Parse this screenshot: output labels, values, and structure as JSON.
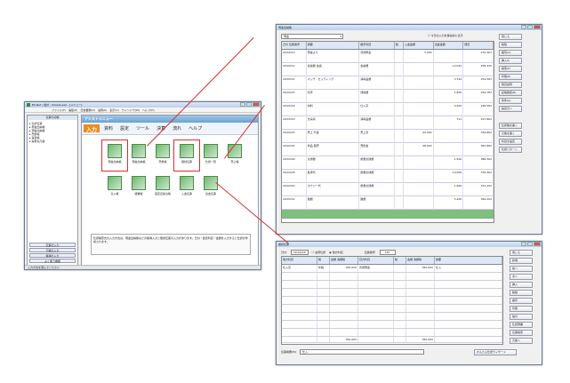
{
  "main_window": {
    "title": "BS-Net / 会計 - Simple.aad - [メニュー]",
    "menu": [
      "ファイル(F)",
      "編集(E)",
      "日常業務(D)",
      "決算(K)",
      "表示(V)",
      "ウィンドウ(W)",
      "ヘルプ(H)"
    ],
    "sidebar_title": "伝票の記帳",
    "tree": [
      "仕訳伝票",
      "現金出納帳",
      "預金出納帳",
      "売掛帳",
      "買掛帳",
      "得意先元帳"
    ],
    "sidebar_buttons": [
      "伝票の入力",
      "元帳の入力",
      "帳簿の入力",
      "よく使う機能"
    ],
    "assist_title": "アシストメニュー",
    "tabs": [
      "入力",
      "資料",
      "設定",
      "ツール",
      "決算",
      "流れ",
      "ヘルプ"
    ],
    "icons": [
      "現金出納帳",
      "預金出納帳",
      "売掛帳",
      "振替伝票",
      "仕訳一覧",
      "売上帳",
      "仕入帳",
      "経費帳",
      "固定資産台帳",
      "入金伝票",
      "出金伝票"
    ],
    "description": "仕訳帳形式の入力方法は、現金出納帳などの帳簿入力と振替伝票の入力があります。日付・勘定科目・金額を入力すると仕訳が作成されます。",
    "status": "入力方法を選んでください"
  },
  "cash_window": {
    "title": "現金出納帳",
    "account": "現金",
    "checkbox_label": "今日の入力を優先的に表示",
    "headers": [
      "日付 伝票番号",
      "摘要",
      "相手科目",
      "税",
      "入金金額",
      "出金金額",
      "残高"
    ],
    "rows": [
      [
        "20/03/10",
        "預金より",
        "普通預金",
        "",
        "3,000",
        "",
        "270,367"
      ],
      [
        "20/03/12",
        "会議費 会議",
        "会議費",
        "",
        "",
        "12,042",
        "258,325"
      ],
      [
        "20/03/12",
        "マッチ、セッティング",
        "消耗品費",
        "",
        "",
        "3,742",
        "254,583"
      ],
      [
        "20/03/15",
        "切手",
        "通信費",
        "",
        "",
        "1,800",
        "252,783"
      ],
      [
        "20/03/18",
        "材料",
        "仕入高",
        "",
        "",
        "4,200",
        "248,583"
      ],
      [
        "20/03/20",
        "文房具",
        "消耗品費",
        "",
        "",
        "721",
        "247,862"
      ],
      [
        "20/03/25",
        "売上 代金",
        "売上高",
        "",
        "92,000",
        "",
        "339,862"
      ],
      [
        "20/03/25",
        "商品 販売",
        "売掛金",
        "",
        "48,000",
        "",
        "387,862"
      ],
      [
        "20/03/28",
        "交通費",
        "旅費交通費",
        "",
        "",
        "1,500",
        "386,362"
      ],
      [
        "20/03/28",
        "駐車代",
        "旅費交通費",
        "",
        "",
        "10,000",
        "376,362"
      ],
      [
        "20/03/29",
        "タクシー代",
        "旅費交通費",
        "",
        "",
        "1,960",
        "374,402"
      ],
      [
        "20/03/31",
        "雑費",
        "雑費",
        "",
        "",
        "5,200",
        "369,202"
      ]
    ],
    "buttons": [
      "閉じる",
      "削除",
      "複写(C)",
      "挿入(I)",
      "検索(F)",
      "印刷(P)",
      "残高試算",
      "記帳確認(R)",
      "条件(A)",
      "指定日へ"
    ],
    "side_buttons2": [
      "仕訳帳を開く",
      "元帳を開く",
      "科目を設定",
      "仕訳パターン"
    ]
  },
  "voucher_window": {
    "title": "振替伝票",
    "date_label": "日付:",
    "date": "20/04/28",
    "options": [
      "決算仕訳",
      "借方科目"
    ],
    "number_label": "伝票番号:",
    "number": "267",
    "headers": [
      "借方科目",
      "税",
      "金額 消費税",
      "貸方科目",
      "税",
      "金額 消費税",
      "摘要"
    ],
    "row1": [
      "仕入高",
      "外税",
      "350,000",
      "普通預金",
      "",
      "350,000",
      "仕入"
    ],
    "footer_label": "伝票摘要(M):",
    "footer_value": "仕入",
    "wizard": "かんたん仕訳ウィザード",
    "total": "350,000",
    "buttons": [
      "閉じる",
      "新規",
      "前へ",
      "次へ",
      "挿入",
      "削除",
      "複写",
      "印刷",
      "貼付",
      "仕訳辞書",
      "伝票検索",
      "元帳へ"
    ]
  }
}
